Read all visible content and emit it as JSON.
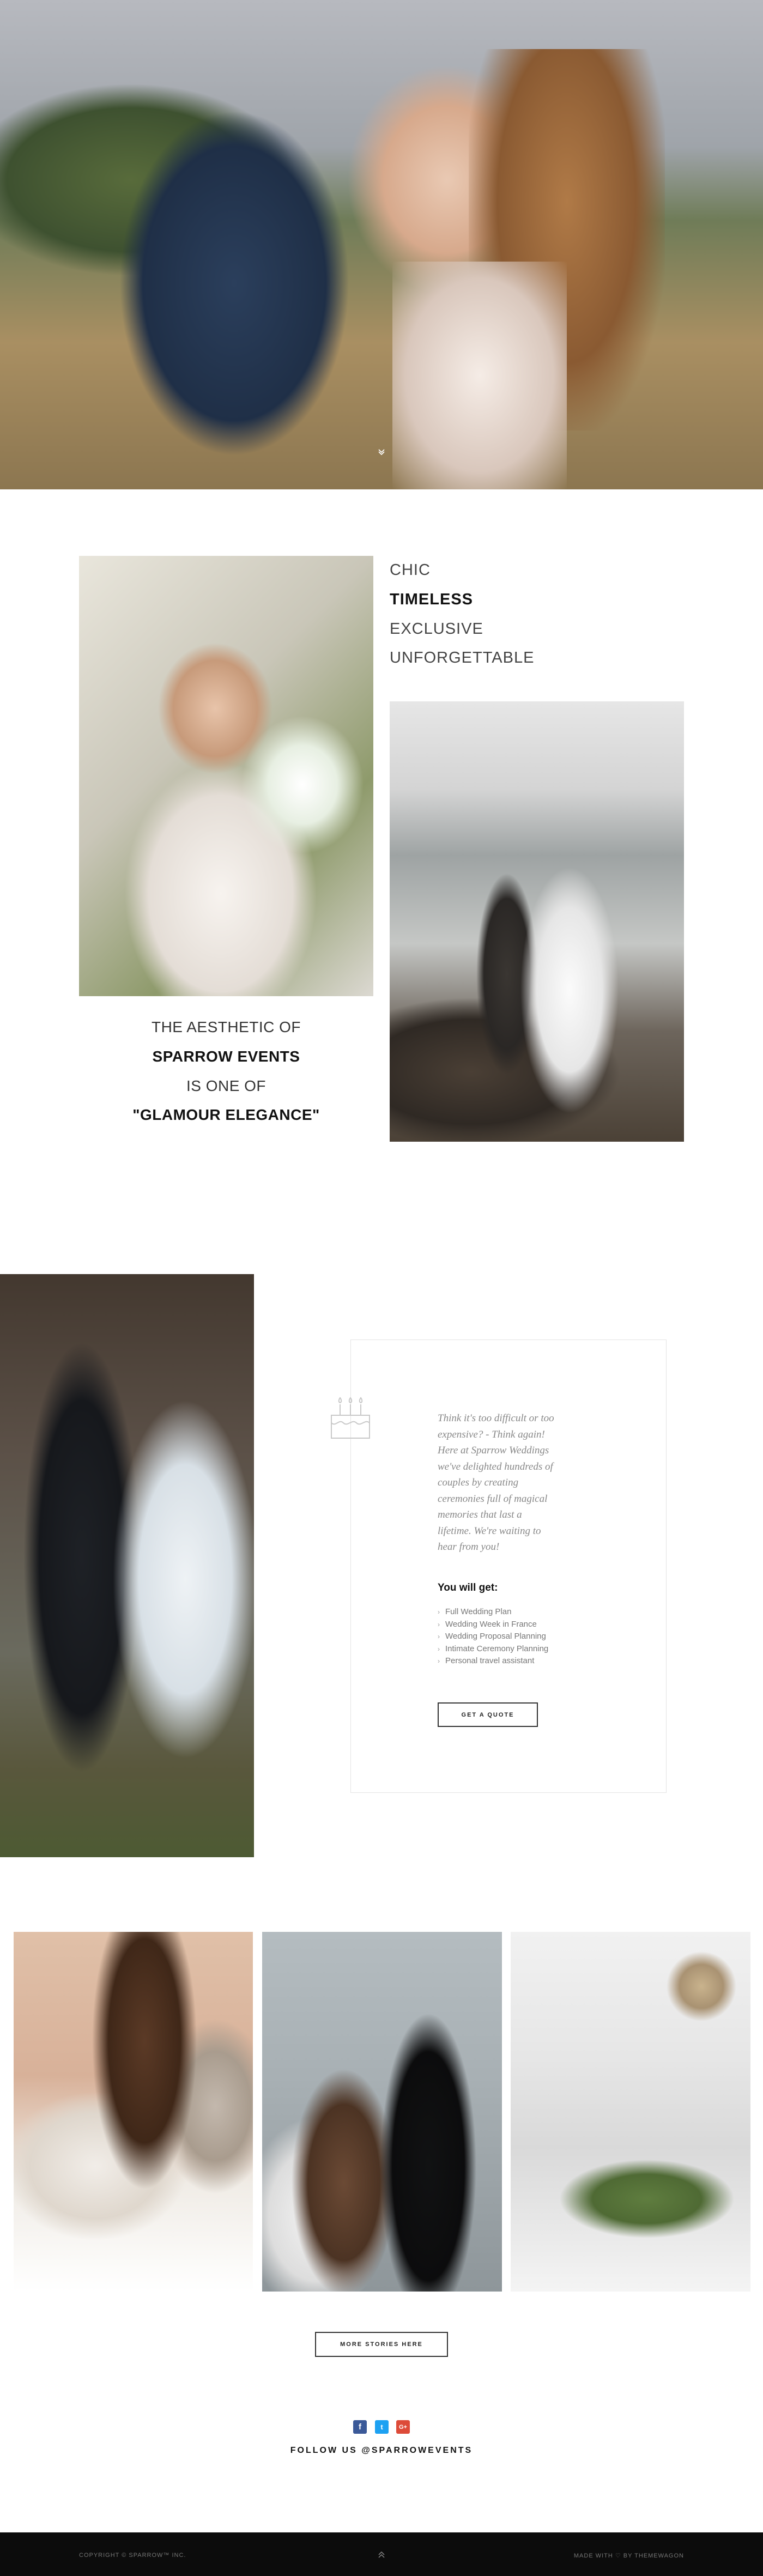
{
  "taglines": [
    "CHIC",
    "TIMELESS",
    "EXCLUSIVE",
    "UNFORGETTABLE"
  ],
  "aesthetic": {
    "line1": "THE AESTHETIC OF",
    "line2": "SPARROW EVENTS",
    "line3": "IS ONE OF",
    "line4": "\"GLAMOUR ELEGANCE\""
  },
  "quote_card": {
    "icon": "birthday-cake-icon",
    "intro_lines": [
      "Think it's too difficult or too",
      "expensive? - Think again!",
      "Here at Sparrow Weddings",
      "we've delighted hundreds of",
      "couples by creating",
      "ceremonies full of magical",
      "memories that last a",
      "lifetime. We're waiting to",
      "hear from you!"
    ],
    "benefits_heading": "You will get:",
    "benefits": [
      "Full Wedding Plan",
      "Wedding Week in France",
      "Wedding Proposal Planning",
      "Intimate Ceremony Planning",
      "Personal travel assistant"
    ],
    "cta_label": "GET A QUOTE"
  },
  "gallery": {
    "more_label": "MORE STORIES HERE"
  },
  "social": {
    "facebook": "f",
    "twitter": "t",
    "google_plus": "G+",
    "follow_text": "FOLLOW US @SPARROWEVENTS"
  },
  "footer": {
    "copyright": "COPYRIGHT © SPARROW™ INC.",
    "made_with": "MADE WITH ♡ BY THEMEWAGON"
  },
  "colors": {
    "footer_bg": "#0c0c0c",
    "facebook": "#3b5998",
    "twitter": "#1da1f2",
    "google_plus": "#dd4b39"
  }
}
